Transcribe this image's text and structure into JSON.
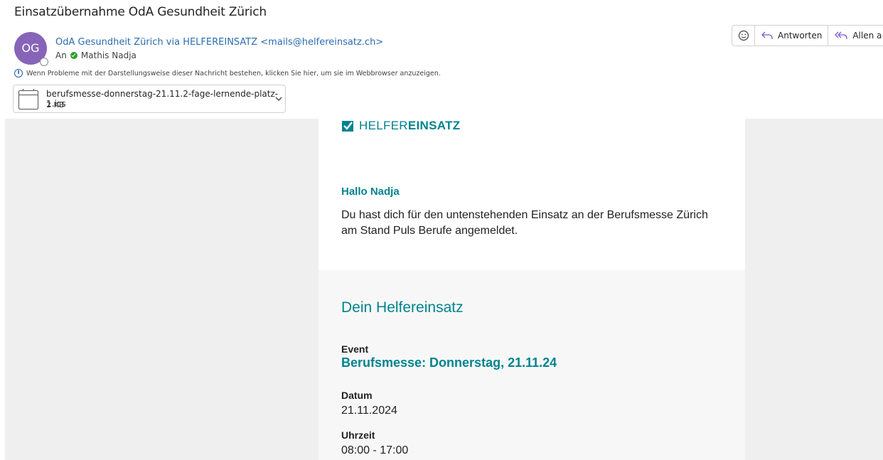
{
  "mail": {
    "subject": "Einsatzübernahme OdA Gesundheit Zürich",
    "avatar_initials": "OG",
    "sender": "OdA Gesundheit Zürich via HELFEREINSATZ <mails@helfereinsatz.ch>",
    "to_label": "An",
    "recipient": "Mathis Nadja",
    "info_message": "Wenn Probleme mit der Darstellungsweise dieser Nachricht bestehen, klicken Sie hier, um sie im Webbrowser anzuzeigen."
  },
  "attachment": {
    "name": "berufsmesse-donnerstag-21.11.2-fage-lernende-platz-1.ics",
    "size": "2 KB",
    "icon": "calendar-icon"
  },
  "toolbar": {
    "reply_label": "Antworten",
    "reply_all_label": "Allen a",
    "icons": [
      "emoji-icon",
      "reply-icon",
      "reply-all-icon"
    ]
  },
  "email_body": {
    "logo_light": "HELFER",
    "logo_bold": "EINSATZ",
    "greeting": "Hallo Nadja",
    "intro": "Du hast dich für den untenstehenden Einsatz an der Berufsmesse Zürich am Stand Puls Berufe angemeldet.",
    "section_title": "Dein Helfereinsatz",
    "event_label": "Event",
    "event_value": "Berufsmesse: Donnerstag, 21.11.24",
    "date_label": "Datum",
    "date_value": "21.11.2024",
    "time_label": "Uhrzeit",
    "time_value": "08:00 - 17:00"
  },
  "colors": {
    "accent": "#00838f",
    "avatar": "#8764b8",
    "link": "#2b6cb0",
    "status_green": "#2e9b2e"
  }
}
